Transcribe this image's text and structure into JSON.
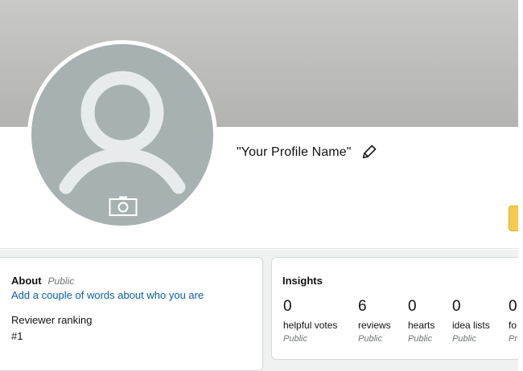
{
  "profile": {
    "name": "\"Your Profile Name\""
  },
  "about": {
    "title": "About",
    "visibility": "Public",
    "add_link": "Add a couple of words about who you are",
    "ranking_label": "Reviewer ranking",
    "ranking_value": "#1"
  },
  "insights": {
    "title": "Insights",
    "stats": [
      {
        "value": "0",
        "label": "helpful votes",
        "visibility": "Public"
      },
      {
        "value": "6",
        "label": "reviews",
        "visibility": "Public"
      },
      {
        "value": "0",
        "label": "hearts",
        "visibility": "Public"
      },
      {
        "value": "0",
        "label": "idea lists",
        "visibility": "Public"
      },
      {
        "value": "0",
        "label": "fo",
        "visibility": "Pr"
      }
    ]
  },
  "icons": {
    "avatar": "person-silhouette-icon",
    "camera": "camera-icon",
    "edit": "pencil-icon"
  },
  "colors": {
    "banner": "#c2c3c1",
    "avatar_bg": "#a7b1b1",
    "link": "#0a5ea8",
    "button_accent": "#f7ca4f"
  }
}
